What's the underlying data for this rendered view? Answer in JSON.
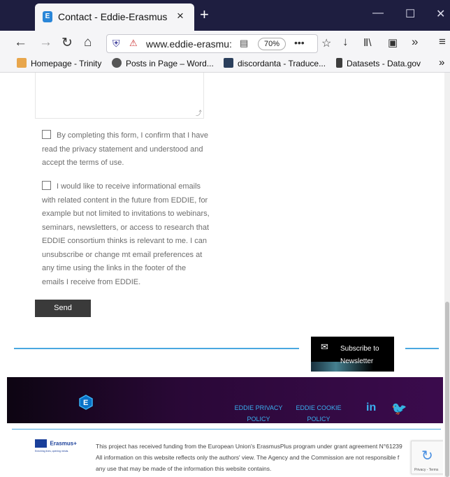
{
  "browser": {
    "tab_title": "Contact - Eddie-Erasmus",
    "tab_close": "×",
    "new_tab": "+",
    "url": "www.eddie-erasmu:",
    "zoom": "70%",
    "bookmarks": [
      {
        "label": "Homepage - Trinity"
      },
      {
        "label": "Posts in Page – Word..."
      },
      {
        "label": "discordanta - Traduce..."
      },
      {
        "label": "Datasets - Data.gov"
      }
    ]
  },
  "form": {
    "consent_text": "By completing this form, I confirm that I have read the privacy statement and understood and accept the terms of use.",
    "newsletter_text": "I would like to receive informational emails with related content in the future from EDDIE, for example but not limited to invitations to webinars, seminars, newsletters, or access to research that EDDIE consortium thinks is relevant to me. I can unsubscribe or change mt email preferences at any time using the links in the footer of the emails I receive from EDDIE.",
    "send_label": "Send"
  },
  "newsletter_box": {
    "line1": "Subscribe to",
    "line2": "Newsletter"
  },
  "footer": {
    "privacy_line1": "EDDIE PRIVACY",
    "privacy_line2": "POLICY",
    "cookie_line1": "EDDIE COOKIE",
    "cookie_line2": "POLICY",
    "erasmus_label": "Erasmus+",
    "erasmus_tag": "Enriching lives, opening minds.",
    "funding_line1": "This project has received funding from the European Union's ErasmusPlus program under grant agreement N°61239",
    "funding_line2": "All information on this website reflects only the authors' view. The Agency and the Commission are not responsible f",
    "funding_line3": "any use that may be made of the information this website contains.",
    "recaptcha_text": "Privacy - Terms"
  }
}
